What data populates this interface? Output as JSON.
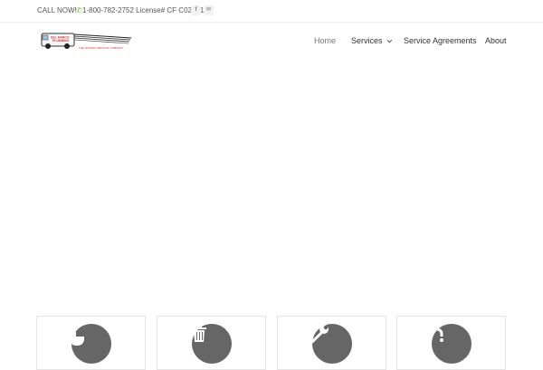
{
  "topbar": {
    "call_now": "CALL NOW!",
    "phone_license": "1-800-782-2752 License# CF C029715",
    "phone_icon": "phone-icon",
    "facebook_icon": "facebook-icon",
    "facebook_glyph": "f",
    "mail_icon": "mail-icon",
    "mail_glyph": "✉"
  },
  "header": {
    "logo_alt": "Del Mar Plumbing",
    "logo_line1": "DEL MARCO",
    "logo_line2": "PLUMBING",
    "logo_tagline": "THE GOLDEN SERVICE COMPANY",
    "colors": {
      "logo_red": "#d32f2f",
      "logo_dark": "#222222"
    }
  },
  "nav": {
    "items": [
      {
        "label": "Home",
        "active": true
      },
      {
        "label": "Services",
        "has_dropdown": true
      },
      {
        "label": "Service Agreements"
      },
      {
        "label": "About"
      }
    ]
  },
  "cards": [
    {
      "icon": "bathtub-icon"
    },
    {
      "icon": "trash-icon"
    },
    {
      "icon": "wrench-icon"
    },
    {
      "icon": "faucet-icon"
    }
  ],
  "colors": {
    "accent_green": "#7cb342",
    "circle_gray": "#666666",
    "border": "#e6e6e6"
  }
}
